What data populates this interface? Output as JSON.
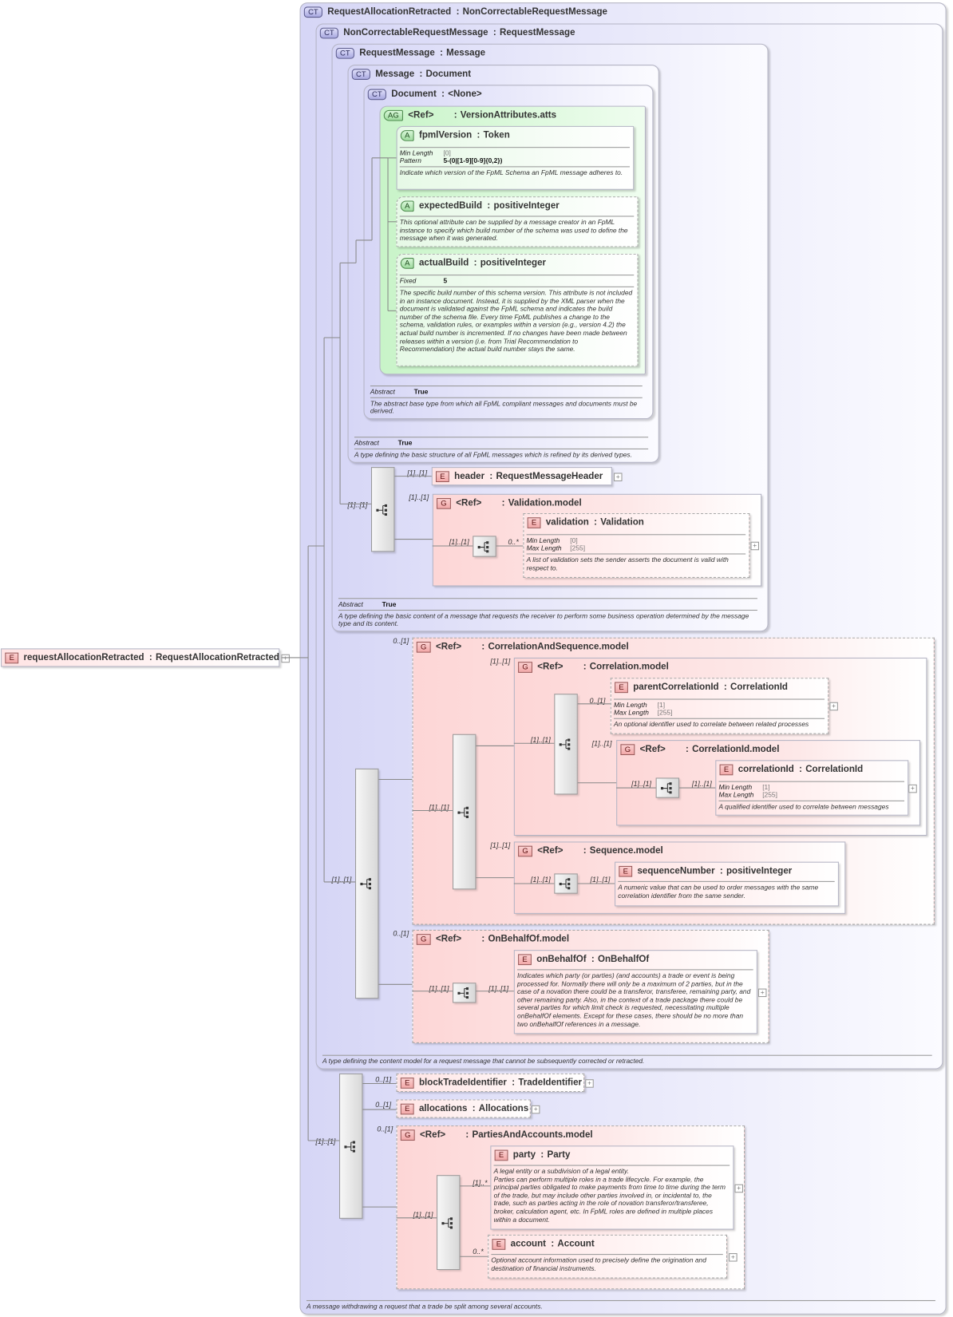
{
  "nodes": {
    "ct1": {
      "badge": "CT",
      "name": "RequestAllocationRetracted",
      "type": "NonCorrectableRequestMessage",
      "desc": "A message withdrawing a request that a trade be split among several accounts."
    },
    "ct2": {
      "badge": "CT",
      "name": "NonCorrectableRequestMessage",
      "type": "RequestMessage",
      "desc": "A type defining the content model for a request message that cannot be subsequently corrected or retracted."
    },
    "ct3": {
      "badge": "CT",
      "name": "RequestMessage",
      "type": "Message",
      "facets": [
        {
          "label": "Abstract",
          "value": "True"
        }
      ],
      "desc": "A type defining the basic content of a message that requests the receiver to perform some business operation determined by the message type and its content."
    },
    "ct4": {
      "badge": "CT",
      "name": "Message",
      "type": "Document",
      "facets": [
        {
          "label": "Abstract",
          "value": "True"
        }
      ],
      "desc": "A type defining the basic structure of all FpML messages which is refined by its derived types."
    },
    "ct5": {
      "badge": "CT",
      "name": "Document",
      "type": "<None>",
      "facets": [
        {
          "label": "Abstract",
          "value": "True"
        }
      ],
      "desc": "The abstract base type from which all FpML compliant messages and documents must be derived."
    },
    "ag": {
      "badge": "AG",
      "name": "<Ref>",
      "type": "VersionAttributes.atts"
    },
    "fpmlVersion": {
      "badge": "A",
      "name": "fpmlVersion",
      "type": "Token",
      "facets": [
        {
          "label": "Min Length",
          "value": "[0]"
        },
        {
          "label": "Pattern",
          "value": "5-(0|[1-9][0-9]{0,2})"
        }
      ],
      "desc": "Indicate which version of the FpML Schema an FpML message adheres to."
    },
    "expectedBuild": {
      "badge": "A",
      "name": "expectedBuild",
      "type": "positiveInteger",
      "desc": "This optional attribute can be supplied by a message creator in an FpML instance to specify which build number of the schema was used to define the message when it was generated."
    },
    "actualBuild": {
      "badge": "A",
      "name": "actualBuild",
      "type": "positiveInteger",
      "facets": [
        {
          "label": "Fixed",
          "value": "5"
        }
      ],
      "desc": "The specific build number of this schema version. This attribute is not included in an instance document. Instead, it is supplied by the XML parser when the document is validated against the FpML schema and indicates the build number of the schema file. Every time FpML publishes a change to the schema, validation rules, or examples within a version (e.g., version 4.2) the actual build number is incremented. If no changes have been made between releases within a version (i.e. from Trial Recommendation to Recommendation) the actual build number stays the same."
    },
    "header": {
      "badge": "E",
      "name": "header",
      "type": "RequestMessageHeader"
    },
    "validationModel": {
      "badge": "G",
      "name": "<Ref>",
      "type": "Validation.model"
    },
    "validation": {
      "badge": "E",
      "name": "validation",
      "type": "Validation",
      "facets": [
        {
          "label": "Min Length",
          "value": "[0]"
        },
        {
          "label": "Max Length",
          "value": "[255]"
        }
      ],
      "desc": "A list of validation sets the sender asserts the document is valid with respect to."
    },
    "corrSeqModel": {
      "badge": "G",
      "name": "<Ref>",
      "type": "CorrelationAndSequence.model"
    },
    "correlationModel": {
      "badge": "G",
      "name": "<Ref>",
      "type": "Correlation.model"
    },
    "parentCorrelationId": {
      "badge": "E",
      "name": "parentCorrelationId",
      "type": "CorrelationId",
      "facets": [
        {
          "label": "Min Length",
          "value": "[1]"
        },
        {
          "label": "Max Length",
          "value": "[255]"
        }
      ],
      "desc": "An optional identifier used to correlate between related processes"
    },
    "correlationIdModel": {
      "badge": "G",
      "name": "<Ref>",
      "type": "CorrelationId.model"
    },
    "correlationId": {
      "badge": "E",
      "name": "correlationId",
      "type": "CorrelationId",
      "facets": [
        {
          "label": "Min Length",
          "value": "[1]"
        },
        {
          "label": "Max Length",
          "value": "[255]"
        }
      ],
      "desc": "A qualified identifier used to correlate between messages"
    },
    "sequenceModel": {
      "badge": "G",
      "name": "<Ref>",
      "type": "Sequence.model"
    },
    "sequenceNumber": {
      "badge": "E",
      "name": "sequenceNumber",
      "type": "positiveInteger",
      "desc": "A numeric value that can be used to order messages with the same correlation identifier from the same sender."
    },
    "onBehalfOfModel": {
      "badge": "G",
      "name": "<Ref>",
      "type": "OnBehalfOf.model"
    },
    "onBehalfOf": {
      "badge": "E",
      "name": "onBehalfOf",
      "type": "OnBehalfOf",
      "desc": "Indicates which party (or parties) (and accounts) a trade or event is being processed for. Normally there will only be a maximum of 2 parties, but in the case of a novation there could be a transferor, transferee, remaining party, and other remaining party. Also, in the context of a trade package there could be several parties for which limit check is requested, necessitating multiple onBehalfOf elements. Except for these cases, there should be no more than two onBehalfOf references in a message."
    },
    "blockTradeIdentifier": {
      "badge": "E",
      "name": "blockTradeIdentifier",
      "type": "TradeIdentifier"
    },
    "allocations": {
      "badge": "E",
      "name": "allocations",
      "type": "Allocations"
    },
    "partiesModel": {
      "badge": "G",
      "name": "<Ref>",
      "type": "PartiesAndAccounts.model"
    },
    "party": {
      "badge": "E",
      "name": "party",
      "type": "Party",
      "desc": "A legal entity or a subdivision of a legal entity.\nParties can perform multiple roles in a trade lifecycle. For example, the principal parties obligated to make payments from time to time during the term of the trade, but may include other parties involved in, or incidental to, the trade, such as parties acting in the role of novation transferor/transferee, broker, calculation agent, etc. In FpML roles are defined in multiple places within a document."
    },
    "account": {
      "badge": "E",
      "name": "account",
      "type": "Account",
      "desc": "Optional account information used to precisely define the origination and destination of financial instruments."
    },
    "root": {
      "badge": "E",
      "name": "requestAllocationRetracted",
      "type": "RequestAllocationRetracted"
    }
  },
  "separator": ":",
  "expand_symbol": "+",
  "cardinalities": [
    "[1]..[1]",
    "[1]..[1]",
    "[1]..[1]",
    "[1]..[1]",
    "0..*",
    "[1]..[1]",
    "0..[1]",
    "[1]..[1]",
    "[1]..[1]",
    "[1]..[1]",
    "0..[1]",
    "[1]..[1]",
    "[1]..[1]",
    "[1]..[1]",
    "[1]..[1]",
    "[1]..[1]",
    "[1]..[1]",
    "0..[1]",
    "[1]..[1]",
    "[1]..[1]",
    "[1]..[1]",
    "0..[1]",
    "0..[1]",
    "0..[1]",
    "[1]..[1]",
    "[1]..*",
    "0..*"
  ]
}
